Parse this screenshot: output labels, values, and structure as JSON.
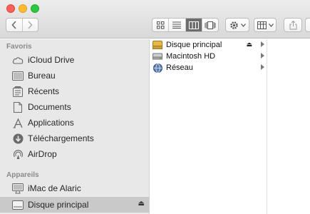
{
  "toolbar": {
    "back_icon": "chevron-left-icon",
    "forward_icon": "chevron-right-icon",
    "views": [
      "icon-view",
      "list-view",
      "column-view",
      "coverflow-view"
    ],
    "active_view": "column-view",
    "action_icon": "gear-icon",
    "arrange_icon": "arrange-grid-icon",
    "share_icon": "share-icon"
  },
  "sidebar": {
    "favorites_title": "Favoris",
    "favorites": [
      {
        "label": "iCloud Drive",
        "icon": "cloud-icon"
      },
      {
        "label": "Bureau",
        "icon": "desktop-icon"
      },
      {
        "label": "Récents",
        "icon": "recents-icon"
      },
      {
        "label": "Documents",
        "icon": "document-icon"
      },
      {
        "label": "Applications",
        "icon": "applications-icon"
      },
      {
        "label": "Téléchargements",
        "icon": "download-icon"
      },
      {
        "label": "AirDrop",
        "icon": "airdrop-icon"
      }
    ],
    "devices_title": "Appareils",
    "devices": [
      {
        "label": "iMac de Alaric",
        "icon": "imac-icon"
      },
      {
        "label": "Disque principal",
        "icon": "disk-icon",
        "selected": true,
        "eject_icon": "eject-icon"
      }
    ]
  },
  "column": {
    "items": [
      {
        "label": "Disque principal",
        "icon": "disk-icon",
        "eject": true
      },
      {
        "label": "Macintosh HD",
        "icon": "hard-drive-icon",
        "eject": false
      },
      {
        "label": "Réseau",
        "icon": "network-globe-icon",
        "eject": false
      }
    ]
  },
  "colors": {
    "sidebar_bg": "#e8e8e8",
    "selection": "#c9c9c9",
    "toolbar_active": "#6c6c6c"
  }
}
